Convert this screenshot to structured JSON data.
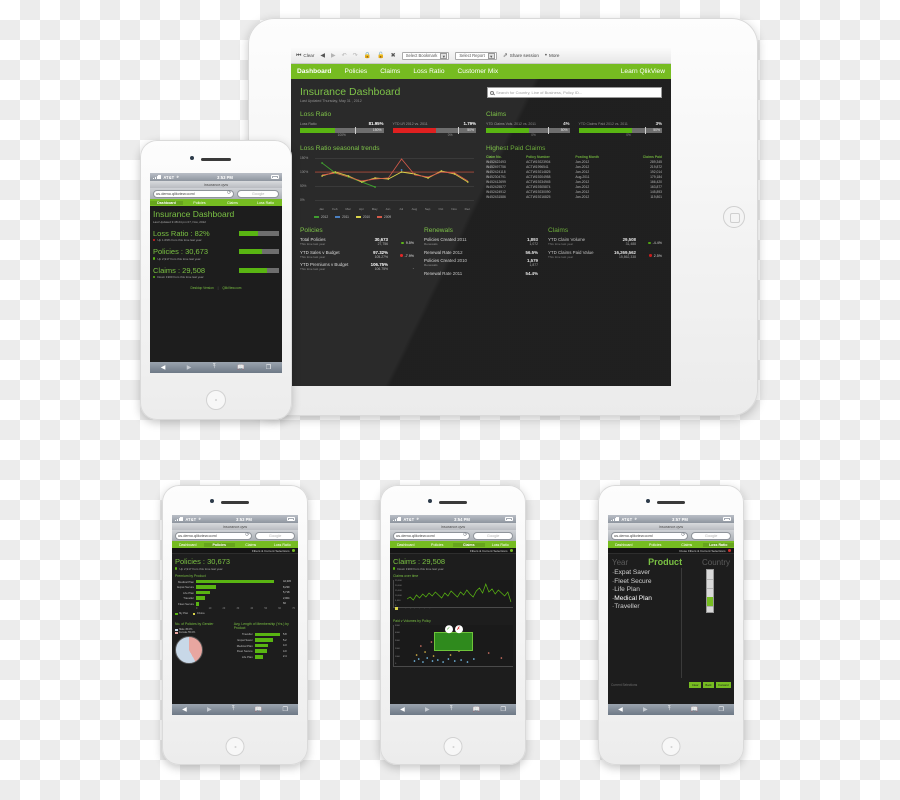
{
  "ipad": {
    "toolbar": {
      "clear_label": "Clear",
      "icons": [
        "clear-icon",
        "back-icon",
        "forward-icon",
        "undo-icon",
        "redo-icon",
        "lock-icon",
        "unlock-icon",
        "help-icon"
      ],
      "bookmark_select": "Select Bookmark",
      "report_select": "Select Report",
      "share_label": "Share session",
      "more_label": "More"
    },
    "nav": {
      "items": [
        "Dashboard",
        "Policies",
        "Claims",
        "Loss Ratio",
        "Customer Mix"
      ],
      "active": "Dashboard",
      "right_link": "Learn QlikView"
    },
    "header": {
      "title": "Insurance Dashboard",
      "subtitle": "Last Updated Thursday, May 31 , 2012",
      "search_placeholder": "Search for Country, Line of Business, Policy ID..."
    },
    "loss_ratio": {
      "heading": "Loss Ratio",
      "kpis": [
        {
          "label": "Loss Ratio",
          "value": "81.95%",
          "end": "150%",
          "below": "100%",
          "fill_pct": 42,
          "mark_pct": 66,
          "color": "green"
        },
        {
          "label": "YTD LR 2012 vs. 2011",
          "value": "1.79%",
          "end": "50%",
          "below": "0%",
          "fill_pct": 52,
          "mark_pct": 78,
          "color": "red"
        }
      ]
    },
    "claims_bars": {
      "heading": "Claims",
      "kpis": [
        {
          "label": "YTD Claims Vols. 2012 vs. 2011",
          "value": "4%",
          "end": "50%",
          "below": "0%",
          "fill_pct": 52,
          "mark_pct": 74,
          "color": "green"
        },
        {
          "label": "YTD Claims Paid 2012 vs. 2011",
          "value": "3%",
          "end": "50%",
          "below": "0%",
          "fill_pct": 64,
          "mark_pct": 80,
          "color": "green"
        }
      ]
    },
    "seasonal": {
      "heading": "Loss Ratio seasonal trends"
    },
    "highest_paid": {
      "heading": "Highest Paid Claims",
      "columns": [
        "Claim No.",
        "Policy Number",
        "Posting Month",
        "Claims Paid"
      ],
      "rows": [
        [
          "IN452422493",
          "ACTW19223904",
          "Jan-2012",
          "289,345"
        ],
        [
          "IN452497756",
          "ACTW1996541",
          "Jan-2012",
          "219,872"
        ],
        [
          "IN452424118",
          "ACTW19214825",
          "Jan-2012",
          "192,014"
        ],
        [
          "IN452304791",
          "ACTW19204958",
          "Aug-2011",
          "179,184"
        ],
        [
          "IN452412699",
          "ACTW19234945",
          "Jan-2012",
          "166,420"
        ],
        [
          "IN452425577",
          "ACTW19305874",
          "Jan-2012",
          "163,877"
        ],
        [
          "IN452424912",
          "ACTW19230090",
          "Jan-2012",
          "145,893"
        ],
        [
          "IN452431586",
          "ACTW19216825",
          "Jan-2012",
          "119,801"
        ]
      ]
    },
    "policies": {
      "heading": "Policies",
      "rows": [
        {
          "label": "Total Policies",
          "sub": "This time last year",
          "value": "30,673",
          "prev": "27,756",
          "delta": "9.5%",
          "dot": "g"
        },
        {
          "label": "YTD Sales v Budget",
          "sub": "This time last year",
          "value": "97.32%",
          "prev": "105.27%",
          "delta": "-7.9%",
          "dot": "r"
        },
        {
          "label": "YTD Premiums v Budget",
          "sub": "This time last year",
          "value": "106.75%",
          "prev": "106.75%",
          "delta": "-",
          "dot": "n"
        }
      ]
    },
    "renewals": {
      "heading": "Renewals",
      "rows": [
        {
          "label": "Policies Created 2011",
          "sub": "Renewals",
          "value": "1,893",
          "prev": "1,072",
          "delta": "",
          "dot": ""
        },
        {
          "label": "Renewal Rate 2012",
          "sub": "",
          "value": "56.5%",
          "prev": "",
          "delta": "",
          "dot": ""
        },
        {
          "label": "Policies Created 2010",
          "sub": "Renewals",
          "value": "1,579",
          "prev": "1,877",
          "delta": "",
          "dot": ""
        },
        {
          "label": "Renewal Rate 2011",
          "sub": "",
          "value": "54.4%",
          "prev": "",
          "delta": "",
          "dot": ""
        }
      ]
    },
    "claims_kpi": {
      "heading": "Claims",
      "rows": [
        {
          "label": "YTD Claim Volume",
          "sub": "This time last year",
          "value": "29,508",
          "prev": "31,488",
          "delta": "-4.4%",
          "dot": "g"
        },
        {
          "label": "YTD Claims Paid Value",
          "sub": "This time last year",
          "value": "16,269,562",
          "prev": "15,862,338",
          "delta": "2.5%",
          "dot": "r"
        }
      ]
    }
  },
  "chart_data": {
    "type": "line",
    "title": "Loss Ratio seasonal trends",
    "xlabel": "",
    "ylabel": "",
    "categories": [
      "Jan",
      "Feb",
      "Mar",
      "Apr",
      "May",
      "Jun",
      "Jul",
      "Aug",
      "Sep",
      "Oct",
      "Nov",
      "Dec"
    ],
    "ytick_labels": [
      "0%",
      "50%",
      "100%",
      "150%"
    ],
    "ylim": [
      0,
      150
    ],
    "grid": true,
    "legend_position": "bottom-left",
    "series": [
      {
        "name": "2012",
        "color": "#3f9b2f",
        "values": [
          128,
          99,
          85,
          70,
          57,
          null,
          null,
          null,
          null,
          null,
          null,
          null
        ]
      },
      {
        "name": "2011",
        "color": "#4a7fc1",
        "values": [
          null,
          null,
          null,
          null,
          null,
          null,
          104,
          null,
          null,
          null,
          null,
          null
        ]
      },
      {
        "name": "2010",
        "color": "#d9d34a",
        "values": [
          88,
          99,
          87,
          70,
          83,
          79,
          101,
          94,
          82,
          104,
          95,
          68
        ]
      },
      {
        "name": "2009",
        "color": "#d45a4a",
        "values": [
          90,
          98,
          85,
          72,
          82,
          80,
          145,
          92,
          84,
          103,
          96,
          70
        ]
      }
    ],
    "reference_line": {
      "value": 100,
      "color": "#b5432f"
    }
  },
  "phone_left": {
    "status": {
      "carrier": "AT&T",
      "time": "3:53 PM",
      "wifi": "wifi-icon",
      "battery": "battery-icon"
    },
    "page_title": "insurance.qvw",
    "url": "us.demo.qlikview.com/",
    "search_placeholder": "Google",
    "nav": {
      "items": [
        "Dashboard",
        "Policies",
        "Claims",
        "Loss Ratio"
      ],
      "active": "Dashboard"
    },
    "header": {
      "title": "Insurance Dashboard",
      "subtitle": "Last Updated 3:48:24 pm 07, Nov, 2012"
    },
    "kpis": [
      {
        "label": "Loss Ratio : 82%",
        "note": "Up 1.69% from this time last year",
        "dot": "r",
        "fill_pct": 48
      },
      {
        "label": "Policies : 30,673",
        "note": "Up 2,917 from this time last year",
        "dot": "g",
        "fill_pct": 58
      },
      {
        "label": "Claims : 29,508",
        "note": "Down 1900 from this time last year",
        "dot": "g",
        "fill_pct": 70
      }
    ],
    "footer": {
      "left": "Desktop Version",
      "sep": "|",
      "right": "QlikView.com"
    },
    "toolbar_icons": [
      "back-icon",
      "forward-icon",
      "share-icon",
      "bookmarks-icon",
      "tabs-icon"
    ]
  },
  "phone_bottom_left": {
    "status": {
      "carrier": "AT&T",
      "time": "3:53 PM"
    },
    "page_title": "insurance.qvw",
    "url": "us.demo.qlikview.com/",
    "search_placeholder": "Google",
    "nav": {
      "items": [
        "Dashboard",
        "Policies",
        "Claims",
        "Loss Ratio"
      ],
      "active": "Policies"
    },
    "filters_label": "Filters & Current Selections",
    "header": {
      "title": "Policies : 30,673",
      "note": "Up 2,917 from this time last year"
    },
    "chart1": {
      "title": "Premium by Product",
      "categories": [
        "Medical Plan",
        "Expat Secure",
        "Life Plan",
        "Traveller",
        "Fleet Secure"
      ],
      "values": [
        "42,345",
        "8,239",
        "5,718",
        "2,004",
        "60"
      ],
      "bar_pct": [
        92,
        24,
        17,
        10,
        3
      ],
      "axis": [
        "0",
        "10",
        "20",
        "30",
        "40",
        "50",
        "60",
        "70"
      ],
      "legend": [
        "My Plan",
        "Choice"
      ]
    },
    "chart2": {
      "title": "No. of Policies by Gender",
      "legend": [
        "Male    45.0%",
        "Female  55.0%"
      ]
    },
    "chart3": {
      "title": "Avg. Length of Membership (Yrs.) by Product",
      "categories": [
        "Traveller",
        "Expat Saver",
        "Medical Plan",
        "Fleet Secure",
        "Life Plan"
      ],
      "values": [
        "5.8",
        "5.2",
        "4.3",
        "4.0",
        "2.4"
      ],
      "bar_pct": [
        95,
        70,
        52,
        47,
        30
      ]
    }
  },
  "phone_bottom_mid": {
    "status": {
      "carrier": "AT&T",
      "time": "3:54 PM"
    },
    "page_title": "insurance.qvw",
    "url": "us.demo.qlikview.com/",
    "search_placeholder": "Google",
    "nav": {
      "items": [
        "Dashboard",
        "Policies",
        "Claims",
        "Loss Ratio"
      ],
      "active": "Claims"
    },
    "filters_label": "Filters & Current Selections",
    "header": {
      "title": "Claims : 29,508",
      "note": "Down 1900 from this time last year"
    },
    "chart1": {
      "title": "Claims over time",
      "ytick_labels": [
        "25,000",
        "20,000",
        "15,000",
        "10,000",
        "5,000",
        "0"
      ]
    },
    "chart2": {
      "title": "Paid v Volumes by Policy",
      "ytick_labels": [
        "5000",
        "4000",
        "3000",
        "2000",
        "1000",
        "0"
      ],
      "xtick_labels": [
        "0",
        "20",
        "40",
        "60",
        "80",
        "100",
        "120"
      ],
      "accept_icon": "check-icon",
      "reject_icon": "close-icon"
    }
  },
  "phone_bottom_right": {
    "status": {
      "carrier": "AT&T",
      "time": "3:57 PM"
    },
    "page_title": "insurance.qvw",
    "url": "us.demo.qlikview.com/",
    "search_placeholder": "Google",
    "nav": {
      "items": [
        "Dashboard",
        "Policies",
        "Claims",
        "Loss Ratio"
      ],
      "active": "Loss Ratio"
    },
    "filters_label": "Close Filters & Current Selections",
    "filter_tabs": [
      "Year",
      "Product",
      "Country"
    ],
    "filter_tab_active": "Product",
    "filter_items": [
      "Expat Saver",
      "Fleet Secure",
      "Life Plan",
      "Medical Plan",
      "Traveller"
    ],
    "filter_selected": "Medical Plan",
    "current_selections_label": "Current Selections",
    "buttons": [
      "Clear",
      "Back",
      "Forward"
    ]
  }
}
